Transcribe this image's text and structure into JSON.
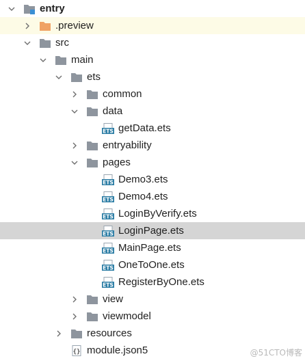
{
  "tree": {
    "entry": "entry",
    "preview": ".preview",
    "src": "src",
    "main": "main",
    "ets": "ets",
    "common": "common",
    "data": "data",
    "getData": "getData.ets",
    "entryability": "entryability",
    "pages": "pages",
    "demo3": "Demo3.ets",
    "demo4": "Demo4.ets",
    "loginByVerify": "LoginByVerify.ets",
    "loginPage": "LoginPage.ets",
    "mainPage": "MainPage.ets",
    "oneToOne": "OneToOne.ets",
    "registerByOne": "RegisterByOne.ets",
    "view": "view",
    "viewmodel": "viewmodel",
    "resources": "resources",
    "moduleJson": "module.json5"
  },
  "icons": {
    "folder": "folder-icon",
    "module_folder": "module-folder-icon",
    "excluded_folder": "excluded-folder-icon",
    "ets_file": "ets-file-icon",
    "json_file": "json5-file-icon"
  },
  "colors": {
    "folder": "#8e959e",
    "excluded_folder": "#f0a264",
    "module_accent": "#3b8fd4",
    "ets_icon": "#2f7fa6",
    "selected_row": "#d5d5d5",
    "highlight_row": "#fdfbe6"
  },
  "watermark": "@51CTO博客"
}
